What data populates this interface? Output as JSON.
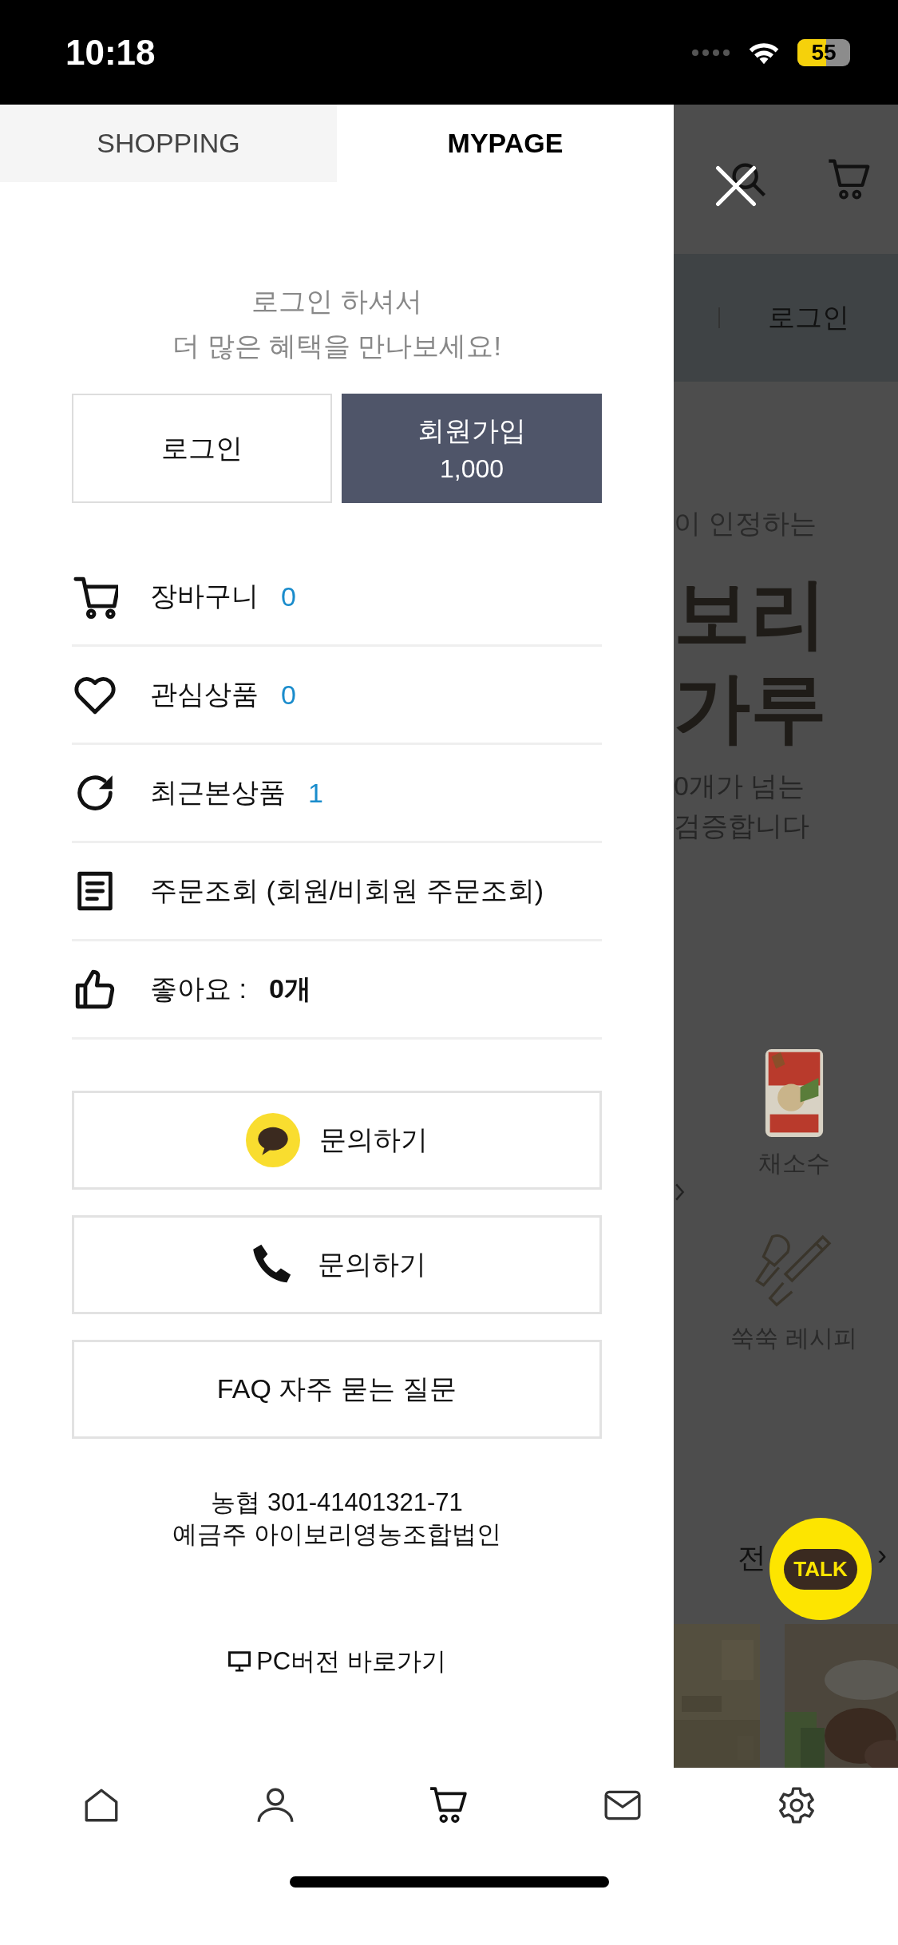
{
  "status_bar": {
    "time": "10:18",
    "battery": "55"
  },
  "drawer": {
    "tabs": [
      {
        "label": "SHOPPING",
        "selected": false
      },
      {
        "label": "MYPAGE",
        "selected": true
      }
    ],
    "login_prompt": [
      "로그인 하셔서",
      "더 많은 혜택을 만나보세요!"
    ],
    "auth_buttons": [
      {
        "kind": "login",
        "label": "로그인"
      },
      {
        "kind": "signup",
        "label": "회원가입",
        "sub": "1,000"
      }
    ],
    "menu": [
      {
        "kind": "cart",
        "label": "장바구니",
        "count": "0",
        "count_bold": false
      },
      {
        "kind": "heart",
        "label": "관심상품",
        "count": "0",
        "count_bold": false
      },
      {
        "kind": "refresh",
        "label": "최근본상품",
        "count": "1",
        "count_bold": false
      },
      {
        "kind": "document",
        "label": "주문조회 (회원/비회원 주문조회)"
      },
      {
        "kind": "thumb",
        "label": "좋아요 :",
        "count": "0개",
        "count_bold": true
      }
    ],
    "contact_buttons": [
      {
        "kind": "kakao",
        "label": "문의하기"
      },
      {
        "kind": "phone",
        "label": "문의하기"
      },
      {
        "kind": "plain",
        "label": "FAQ 자주 묻는 질문"
      }
    ],
    "bank_info": [
      "농협 301-41401321-71",
      "예금주 아이보리영농조합법인"
    ],
    "pc_link": "PC버전 바로가기"
  },
  "background_page": {
    "login": "로그인",
    "headline_top": "이 인정하는",
    "headline": [
      "보리",
      "가루"
    ],
    "subline": [
      "0개가 넘는",
      "검증합니다"
    ],
    "categories": [
      {
        "kind": "picture",
        "label": "채소수"
      },
      {
        "kind": "whisk",
        "label": "쑥쑥 레시피"
      }
    ],
    "more": [
      "전",
      "›"
    ],
    "talk_button": "TALK"
  },
  "bottom_nav": [
    {
      "kind": "home"
    },
    {
      "kind": "person"
    },
    {
      "kind": "cart"
    },
    {
      "kind": "mail"
    },
    {
      "kind": "gear"
    }
  ]
}
